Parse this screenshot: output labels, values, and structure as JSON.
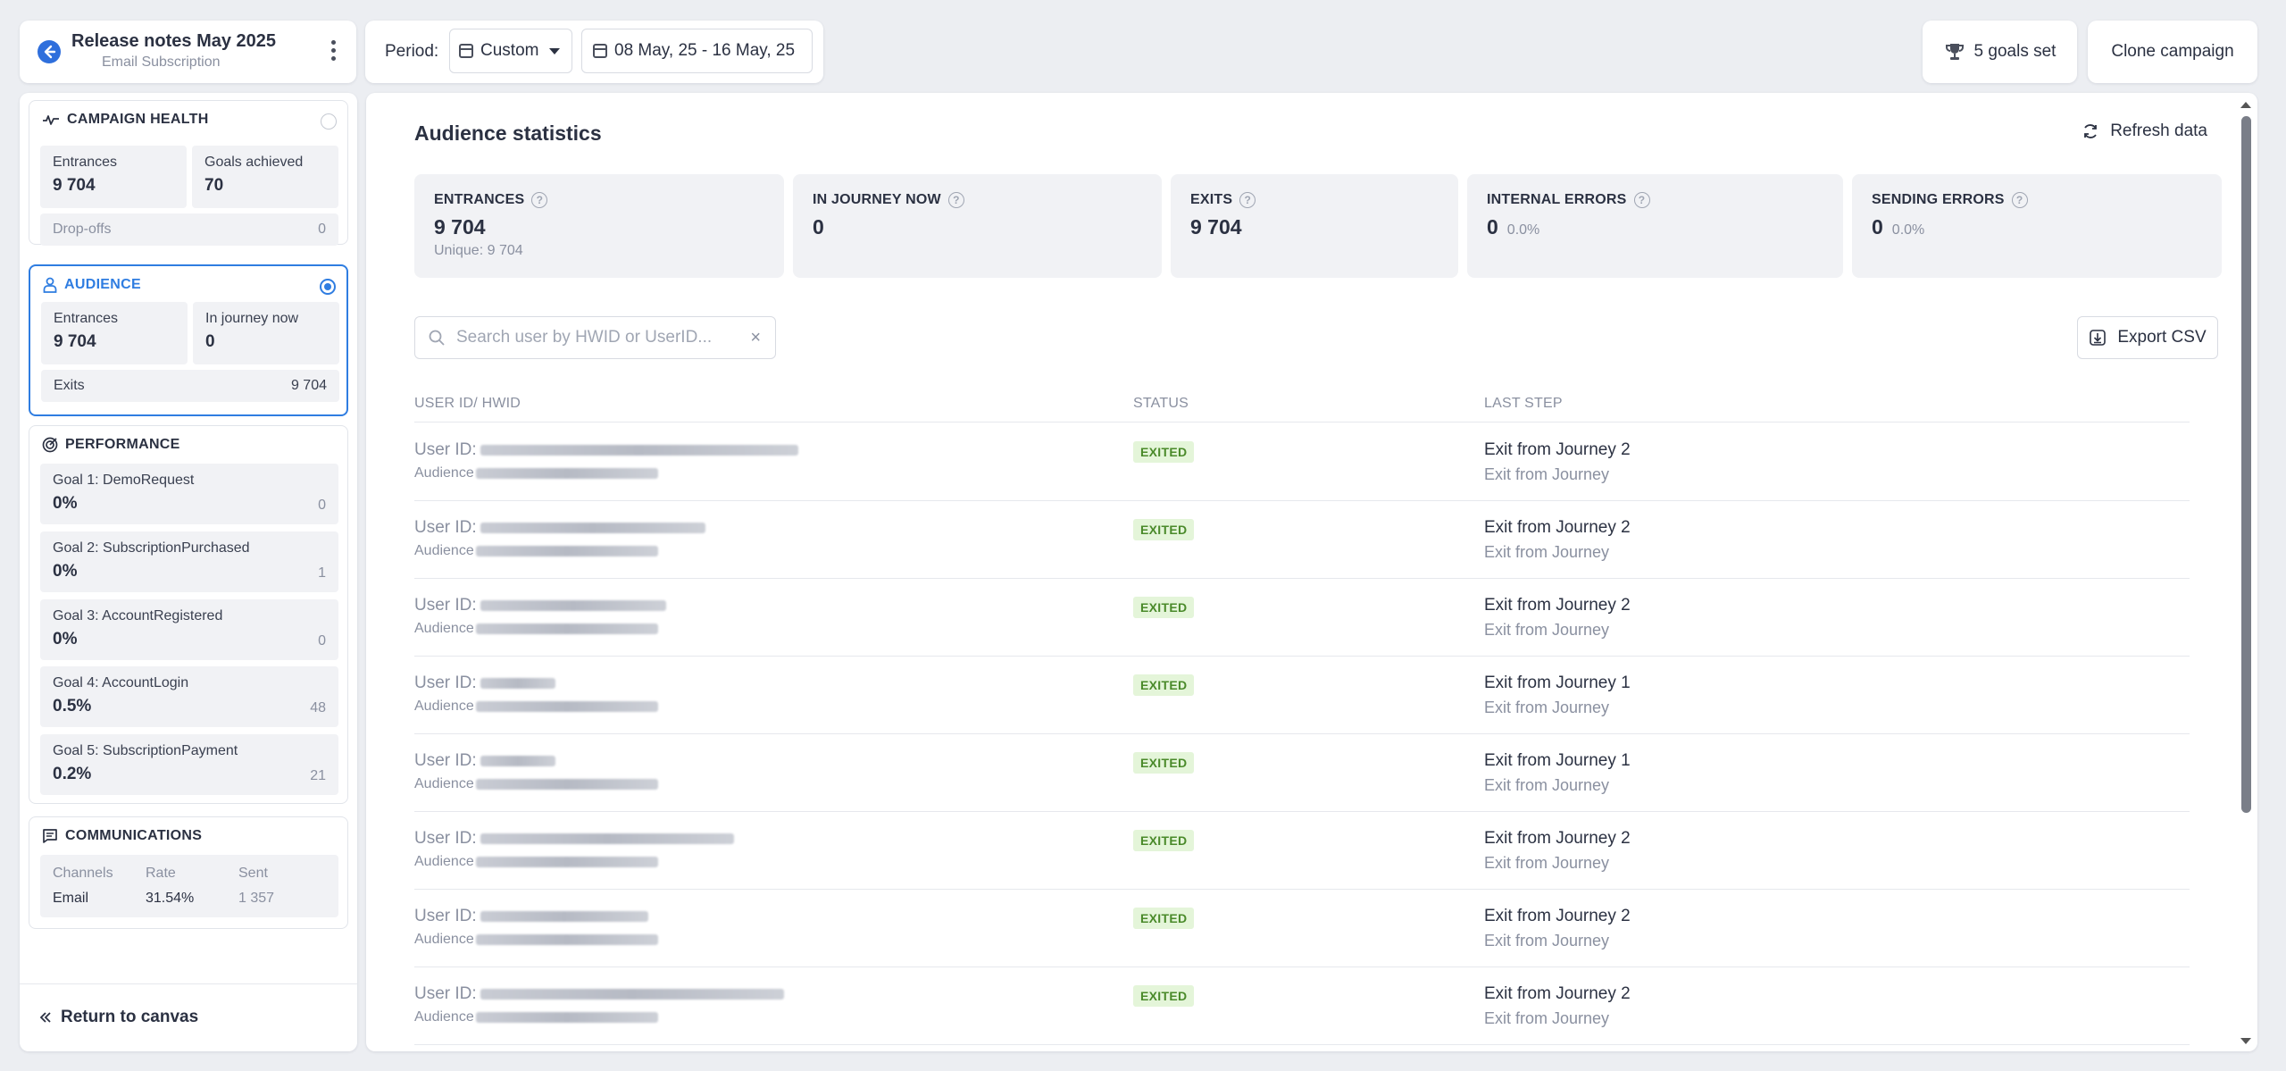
{
  "header": {
    "title": "Release notes May 2025",
    "subtitle": "Email Subscription",
    "period_label": "Period:",
    "period_value": "Custom",
    "date_range": "08 May, 25 - 16 May, 25",
    "goals_label": "5 goals set",
    "clone_label": "Clone campaign"
  },
  "sidebar": {
    "health": {
      "title": "CAMPAIGN HEALTH",
      "entrances_label": "Entrances",
      "entrances_value": "9 704",
      "goals_label": "Goals achieved",
      "goals_value": "70",
      "dropoffs_label": "Drop-offs",
      "dropoffs_value": "0"
    },
    "audience": {
      "title": "AUDIENCE",
      "entrances_label": "Entrances",
      "entrances_value": "9 704",
      "injourney_label": "In journey now",
      "injourney_value": "0",
      "exits_label": "Exits",
      "exits_value": "9 704"
    },
    "performance": {
      "title": "PERFORMANCE",
      "goals": [
        {
          "label": "Goal 1: DemoRequest",
          "rate": "0%",
          "count": "0"
        },
        {
          "label": "Goal 2: SubscriptionPurchased",
          "rate": "0%",
          "count": "1"
        },
        {
          "label": "Goal 3: AccountRegistered",
          "rate": "0%",
          "count": "0"
        },
        {
          "label": "Goal 4: AccountLogin",
          "rate": "0.5%",
          "count": "48"
        },
        {
          "label": "Goal 5: SubscriptionPayment",
          "rate": "0.2%",
          "count": "21"
        }
      ]
    },
    "communications": {
      "title": "COMMUNICATIONS",
      "col_channels": "Channels",
      "col_rate": "Rate",
      "col_sent": "Sent",
      "channel": "Email",
      "rate": "31.54%",
      "sent": "1 357"
    },
    "return_label": "Return to canvas"
  },
  "main": {
    "title": "Audience statistics",
    "refresh_label": "Refresh data",
    "stats": [
      {
        "label": "ENTRANCES",
        "value": "9 704",
        "extra": "Unique: 9 704"
      },
      {
        "label": "IN JOURNEY NOW",
        "value": "0"
      },
      {
        "label": "EXITS",
        "value": "9 704"
      },
      {
        "label": "INTERNAL ERRORS",
        "value": "0",
        "pct": "0.0%"
      },
      {
        "label": "SENDING ERRORS",
        "value": "0",
        "pct": "0.0%"
      }
    ],
    "search_placeholder": "Search user by HWID or UserID...",
    "export_label": "Export CSV",
    "columns": [
      "USER ID/ HWID",
      "STATUS",
      "LAST STEP"
    ],
    "user_prefix": "User ID:",
    "audience_prefix": "Audience",
    "rows": [
      {
        "status": "EXITED",
        "step": "Exit from Journey 2",
        "sub": "Exit from Journey"
      },
      {
        "status": "EXITED",
        "step": "Exit from Journey 2",
        "sub": "Exit from Journey"
      },
      {
        "status": "EXITED",
        "step": "Exit from Journey 2",
        "sub": "Exit from Journey"
      },
      {
        "status": "EXITED",
        "step": "Exit from Journey 1",
        "sub": "Exit from Journey"
      },
      {
        "status": "EXITED",
        "step": "Exit from Journey 1",
        "sub": "Exit from Journey"
      },
      {
        "status": "EXITED",
        "step": "Exit from Journey 2",
        "sub": "Exit from Journey"
      },
      {
        "status": "EXITED",
        "step": "Exit from Journey 2",
        "sub": "Exit from Journey"
      },
      {
        "status": "EXITED",
        "step": "Exit from Journey 2",
        "sub": "Exit from Journey"
      }
    ]
  },
  "colors": {
    "accent": "#2f7de1",
    "badge_bg": "#e4f5d9",
    "badge_text": "#4a8a2a"
  }
}
